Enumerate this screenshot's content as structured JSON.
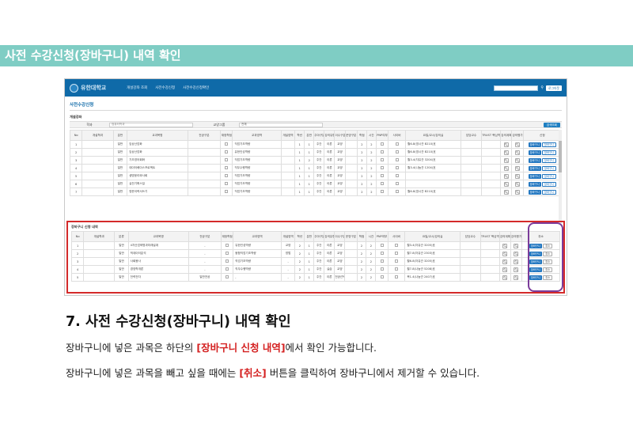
{
  "banner": {
    "title": "사전 수강신청(장바구니) 내역 확인"
  },
  "screenshot": {
    "logo": "유한대학교",
    "nav": [
      "개설강좌 조회",
      "사전수강신청",
      "사전수강신청확인"
    ],
    "logout": "로그아웃",
    "page_title": "사전수강신청",
    "section_label": "개설강좌",
    "filter": {
      "dept_label": "학과",
      "dept_value": "컴퓨터학과",
      "group_label": "교양그룹",
      "group_value": "전체",
      "search_button": "검색조회"
    },
    "table_headers": [
      "No",
      "개설학과",
      "분반",
      "교과목명",
      "전공구분",
      "재정학점",
      "교과영역",
      "개설영역",
      "학년",
      "분반",
      "주야구분",
      "강의유형",
      "이수구분",
      "운영구분",
      "학점",
      "시간",
      "PNP여부",
      "사이버",
      "요일/교시/강의실",
      "담당교수",
      "TRUST 핵심역량",
      "강의계획",
      "강의평가",
      "신청"
    ],
    "rows": [
      {
        "no": "1",
        "type": "일반",
        "course": "임상산업화",
        "area": "직업기초역량",
        "grade": "1",
        "div": "1",
        "shift": "주간",
        "kind": "이론",
        "cat": "교양",
        "credit": "2",
        "hours": "2",
        "room": "월6-8(영시관 B210)호"
      },
      {
        "no": "2",
        "type": "일반",
        "course": "임상산업화",
        "area": "유한인성역량",
        "grade": "1",
        "div": "1",
        "shift": "주간",
        "kind": "이론",
        "cat": "교양",
        "credit": "2",
        "hours": "2",
        "room": "월6-8(영시관 B210)호"
      },
      {
        "no": "3",
        "type": "일반",
        "course": "기초영어회화",
        "area": "직업기초역량",
        "grade": "1",
        "div": "2",
        "shift": "주간",
        "kind": "이론",
        "cat": "교양",
        "credit": "2",
        "hours": "2",
        "room": "월3-4(자유관 3204)호"
      },
      {
        "no": "4",
        "type": "일반",
        "course": "데이터베이스프로젝트",
        "area": "직무수행역량",
        "grade": "1",
        "div": "1",
        "shift": "주간",
        "kind": "이론",
        "cat": "교양",
        "credit": "2",
        "hours": "2",
        "room": "월3-4(나눔관 1204)호"
      },
      {
        "no": "5",
        "type": "일반",
        "course": "생명윤리와사회",
        "area": "직업기초역량",
        "grade": "1",
        "div": "1",
        "shift": "주간",
        "kind": "이론",
        "cat": "교양",
        "credit": "2",
        "hours": "2",
        "room": ""
      },
      {
        "no": "6",
        "type": "일반",
        "course": "실전기획스킬",
        "area": "직업기초역량",
        "grade": "1",
        "div": "1",
        "shift": "주간",
        "kind": "이론",
        "cat": "교양",
        "credit": "2",
        "hours": "2",
        "room": ""
      },
      {
        "no": "7",
        "type": "일반",
        "course": "영문이력서쓰기",
        "area": "직업기초역량",
        "grade": "1",
        "div": "1",
        "shift": "주간",
        "kind": "이론",
        "cat": "교양",
        "credit": "2",
        "hours": "2",
        "room": "월6-8(영시관 B210)호"
      }
    ],
    "cart_title": "장바구니 신청 내역",
    "cart_headers": [
      "No",
      "개설학과",
      "분류",
      "교과목명",
      "전공구분",
      "재정학점",
      "교과영역",
      "개설영역",
      "학년",
      "분반",
      "주야구분",
      "강의유형",
      "이수구분",
      "운영구분",
      "학점",
      "시간",
      "PNP여부",
      "사이버",
      "요일/교시/강의실",
      "담당교수",
      "TRUST 핵심역량",
      "강의계획",
      "강의평가",
      "취소"
    ],
    "cart_rows": [
      {
        "no": "1",
        "type": "일반",
        "course": "4차산업혁명과미래설계",
        "major": "-",
        "area": "유한인성역량",
        "open": "교양",
        "grade": "2",
        "div": "1",
        "shift": "주간",
        "kind": "이론",
        "cat": "교양",
        "credit": "2",
        "hours": "2",
        "room": "월3-4(자유관 3205)호"
      },
      {
        "no": "2",
        "type": "일반",
        "course": "빅데이터분석",
        "major": "-",
        "area": "융합직업기초역량",
        "open": "방법",
        "grade": "2",
        "div": "1",
        "shift": "주간",
        "kind": "이론",
        "cat": "교양",
        "credit": "2",
        "hours": "2",
        "room": "월7-8(자유관 2303)호"
      },
      {
        "no": "3",
        "type": "일반",
        "course": "사회봉사",
        "major": "-",
        "area": "직업기초역량",
        "open": "-",
        "grade": "2",
        "div": "1",
        "shift": "주간",
        "kind": "이론",
        "cat": "교양",
        "credit": "2",
        "hours": "2",
        "room": "월6-8(자유관 3205)호"
      },
      {
        "no": "4",
        "type": "일반",
        "course": "경영학개론",
        "major": "-",
        "area": "직무수행역량",
        "open": "-",
        "grade": "2",
        "div": "1",
        "shift": "주간",
        "kind": "실습",
        "cat": "교양",
        "credit": "2",
        "hours": "2",
        "room": "월7-8(나눔관 5208)호"
      },
      {
        "no": "5",
        "type": "일반",
        "course": "전력전자",
        "major": "일반전공",
        "area": "-",
        "open": "-",
        "grade": "2",
        "div": "1",
        "shift": "주간",
        "kind": "이론",
        "cat": "전공선택",
        "credit": "2",
        "hours": "2",
        "room": "목1-4(나눔관 2407)호"
      }
    ],
    "btn_apply": "장바구니",
    "btn_plan": "장바구니",
    "btn_cancel": "취소"
  },
  "heading": "7. 사전 수강신청(장바구니) 내역 확인",
  "para1": {
    "before": "장바구니에 넣은 과목은 하단의 ",
    "highlight": "[장바구니 신청 내역]",
    "after": "에서 확인 가능합니다."
  },
  "para2": {
    "before": "장바구니에 넣은 과목을 빼고 싶을 때에는 ",
    "highlight": "[취소]",
    "after": " 버튼을 클릭하여 장바구니에서 제거할 수 있습니다."
  }
}
